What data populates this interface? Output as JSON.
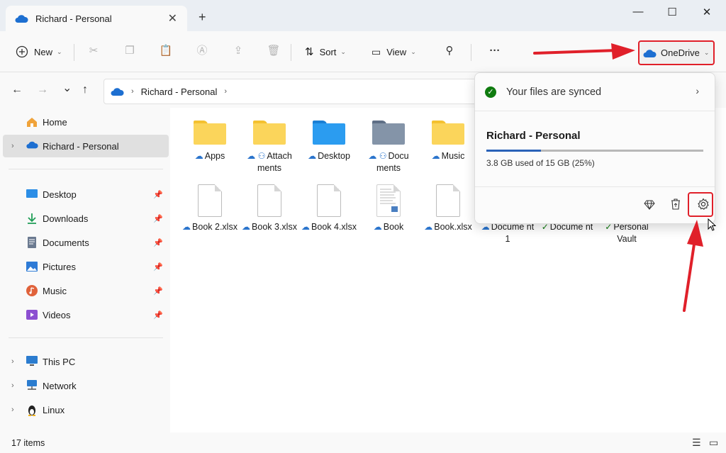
{
  "window": {
    "tab_title": "Richard - Personal",
    "tab_close": "✕",
    "new_tab": "+",
    "minimize": "—",
    "maximize": "☐",
    "close": "✕"
  },
  "toolbar": {
    "new_label": "New",
    "sort_label": "Sort",
    "view_label": "View",
    "more_label": "···",
    "onedrive_label": "OneDrive"
  },
  "navigation": {
    "back": "←",
    "forward": "→",
    "recent": "⌄",
    "up": "↑",
    "breadcrumb": [
      "Richard - Personal"
    ],
    "breadcrumb_sep": "›"
  },
  "sidebar": {
    "top": [
      {
        "label": "Home",
        "icon": "home-icon"
      },
      {
        "label": "Richard - Personal",
        "icon": "onedrive-cloud-icon",
        "selected": true
      }
    ],
    "quick_access": [
      {
        "label": "Desktop",
        "icon": "desktop-icon",
        "color": "#2c8ee6"
      },
      {
        "label": "Downloads",
        "icon": "download-icon",
        "color": "#1f9d55"
      },
      {
        "label": "Documents",
        "icon": "document-icon",
        "color": "#6b7a90"
      },
      {
        "label": "Pictures",
        "icon": "pictures-icon",
        "color": "#2e7bd6"
      },
      {
        "label": "Music",
        "icon": "music-icon",
        "color": "#e0623b"
      },
      {
        "label": "Videos",
        "icon": "videos-icon",
        "color": "#8c4fd1"
      }
    ],
    "devices": [
      {
        "label": "This PC",
        "icon": "computer-icon"
      },
      {
        "label": "Network",
        "icon": "network-icon"
      },
      {
        "label": "Linux",
        "icon": "linux-icon"
      }
    ],
    "pin_glyph": "📌",
    "expander_glyph": "›"
  },
  "files": {
    "row1": [
      {
        "name": "Apps",
        "type": "folder",
        "status": "cloud"
      },
      {
        "name": "Attach ments",
        "type": "folder",
        "status": "cloud-shared"
      },
      {
        "name": "Desktop",
        "type": "folder-blue",
        "status": "cloud"
      },
      {
        "name": "Docu ments",
        "type": "folder-docs",
        "status": "cloud-shared"
      },
      {
        "name": "Music",
        "type": "folder",
        "status": "cloud"
      }
    ],
    "row2": [
      {
        "name": "Book 2.xlsx",
        "type": "doc",
        "status": "cloud"
      },
      {
        "name": "Book 3.xlsx",
        "type": "doc",
        "status": "cloud"
      },
      {
        "name": "Book 4.xlsx",
        "type": "doc",
        "status": "cloud"
      },
      {
        "name": "Book",
        "type": "doc-preview",
        "status": "cloud"
      },
      {
        "name": "Book.xlsx",
        "type": "doc",
        "status": "cloud"
      },
      {
        "name": "Docume nt 1",
        "type": "doc",
        "status": "cloud"
      },
      {
        "name": "Docume nt",
        "type": "doc",
        "status": "synced"
      },
      {
        "name": "Personal Vault",
        "type": "vault",
        "status": "synced"
      }
    ]
  },
  "status": {
    "item_count": "17 items"
  },
  "onedrive_flyout": {
    "sync_status": "Your files are synced",
    "account_name": "Richard - Personal",
    "usage_text": "3.8 GB used of 15 GB (25%)",
    "usage_fraction": 0.25,
    "footer_icons": [
      "premium-diamond-icon",
      "recycle-bin-icon",
      "settings-gear-icon"
    ]
  },
  "colors": {
    "accent": "#2a62b8",
    "annotation_red": "#e0202a",
    "onedrive_blue": "#2a74cc",
    "synced_green": "#0f7b0f"
  }
}
